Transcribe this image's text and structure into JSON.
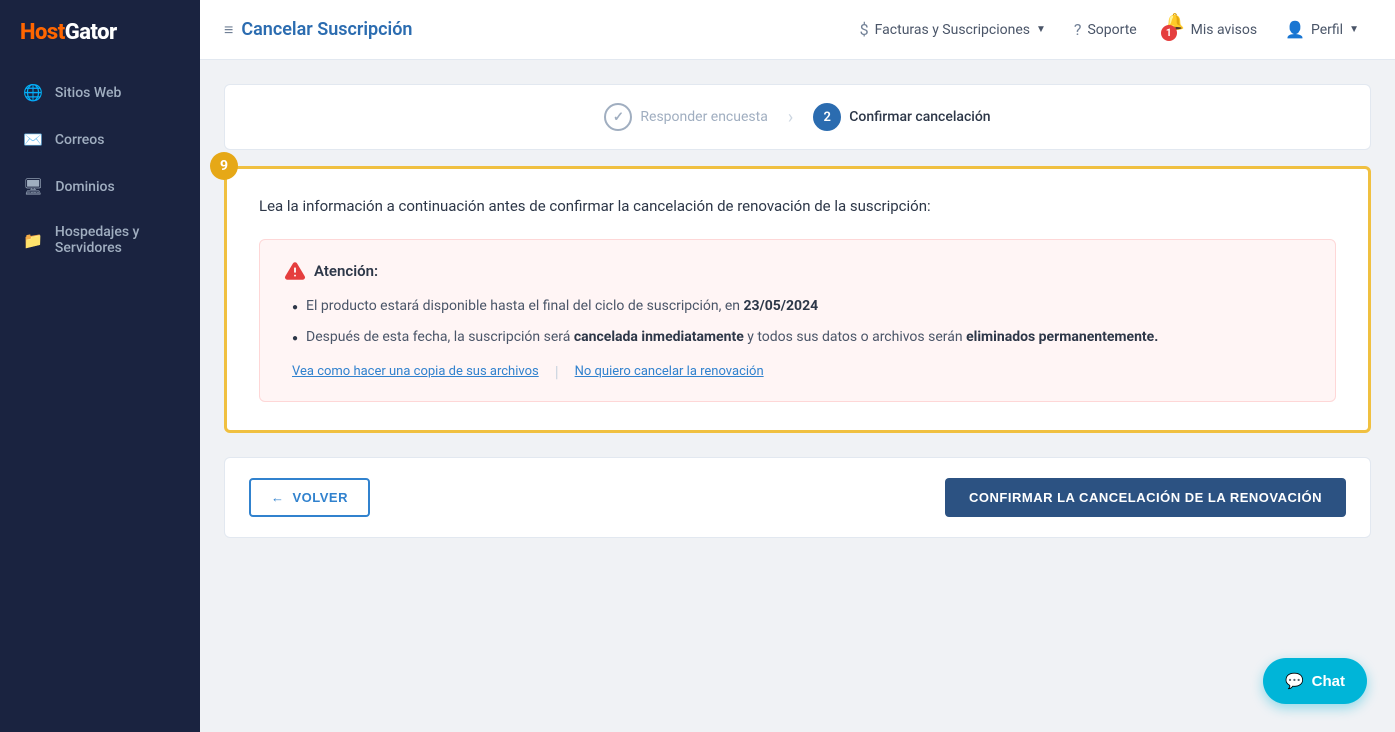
{
  "brand": {
    "name_part1": "Host",
    "name_part2": "Gator"
  },
  "sidebar": {
    "items": [
      {
        "id": "sitios-web",
        "label": "Sitios Web",
        "icon": "🌐"
      },
      {
        "id": "correos",
        "label": "Correos",
        "icon": "✉️"
      },
      {
        "id": "dominios",
        "label": "Dominios",
        "icon": "🖥"
      },
      {
        "id": "hospedajes",
        "label": "Hospedajes y Servidores",
        "icon": "📁"
      }
    ]
  },
  "header": {
    "page_icon": "≡",
    "title": "Cancelar Suscripción",
    "nav_items": [
      {
        "id": "facturas",
        "label": "Facturas y Suscripciones",
        "icon": "$",
        "has_chevron": true
      },
      {
        "id": "soporte",
        "label": "Soporte",
        "icon": "?",
        "has_chevron": false
      },
      {
        "id": "avisos",
        "label": "Mis avisos",
        "icon": "🔔",
        "has_chevron": false,
        "badge": "1"
      },
      {
        "id": "perfil",
        "label": "Perfil",
        "icon": "👤",
        "has_chevron": true
      }
    ]
  },
  "steps": [
    {
      "id": "step1",
      "label": "Responder encuesta",
      "state": "completed",
      "number": "✓"
    },
    {
      "id": "step2",
      "label": "Confirmar cancelación",
      "state": "active",
      "number": "2"
    }
  ],
  "panel": {
    "step_badge": "9",
    "intro_text": "Lea la información a continuación antes de confirmar la cancelación de renovación de la suscripción:",
    "alert": {
      "title": "Atención:",
      "items": [
        {
          "text_before": "El producto estará disponible hasta el final del ciclo de suscripción, en ",
          "bold": "23/05/2024",
          "text_after": ""
        },
        {
          "text_before": "Después de esta fecha, la suscripción será ",
          "bold1": "cancelada inmediatamente",
          "text_middle": " y todos sus datos o archivos serán ",
          "bold2": "eliminados permanentemente.",
          "text_after": ""
        }
      ],
      "links": [
        {
          "id": "copy-link",
          "label": "Vea como hacer una copia de sus archivos"
        },
        {
          "id": "no-cancel-link",
          "label": "No quiero cancelar la renovación"
        }
      ]
    }
  },
  "actions": {
    "back_label": "VOLVER",
    "confirm_label": "CONFIRMAR LA CANCELACIÓN DE LA RENOVACIÓN"
  },
  "chat": {
    "label": "Chat",
    "icon": "💬"
  }
}
